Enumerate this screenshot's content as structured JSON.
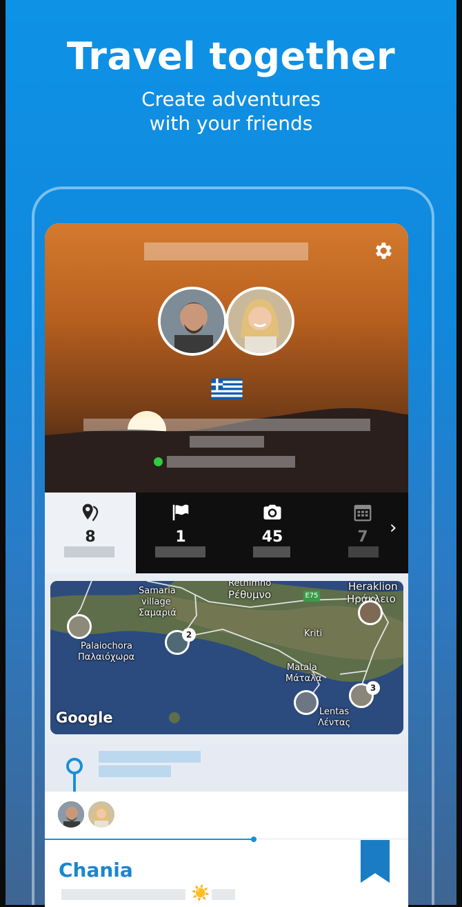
{
  "headline": {
    "title": "Travel together",
    "subtitle_line1": "Create adventures",
    "subtitle_line2": "with your friends"
  },
  "hero": {
    "flag_emoji": "🇬🇷",
    "settings_icon": "gear-icon",
    "online_color": "#2ecc40"
  },
  "stats": [
    {
      "icon": "location-pins-icon",
      "value": "8",
      "active": true
    },
    {
      "icon": "flag-icon",
      "value": "1",
      "active": false
    },
    {
      "icon": "camera-icon",
      "value": "45",
      "active": false
    },
    {
      "icon": "calendar-icon",
      "value": "7",
      "active": false
    }
  ],
  "map": {
    "labels": {
      "rethimno_en": "Rethimno",
      "rethimno_gr": "Ρέθυμνο",
      "heraklion_en": "Heraklion",
      "heraklion_gr": "Ηράκλειο",
      "samaria_1": "Samaria",
      "samaria_2": "village",
      "samaria_3": "Σαμαριά",
      "palaiochora_en": "Palaiochora",
      "palaiochora_gr": "Παλαιόχωρα",
      "kriti": "Kriti",
      "matala_en": "Matala",
      "matala_gr": "Μάταλα",
      "lentas_en": "Lentas",
      "lentas_gr": "Λέντας",
      "road": "E75"
    },
    "badges": [
      "2",
      "3"
    ],
    "attribution": "Google"
  },
  "trip": {
    "city": "Chania",
    "weather_icon": "☀️"
  },
  "colors": {
    "accent": "#1a86cf",
    "background": "#0e92e6"
  }
}
